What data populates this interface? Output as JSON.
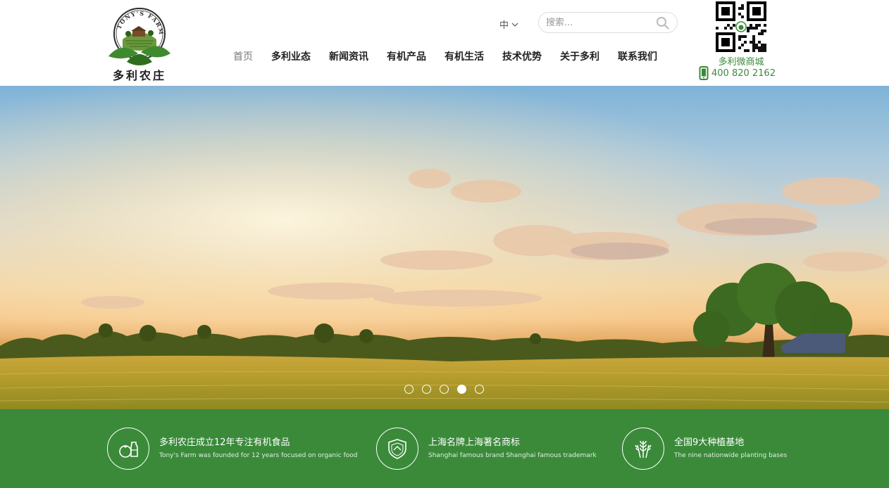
{
  "brand": {
    "name": "多利农庄",
    "badge_text": "TONY'S FARM"
  },
  "header": {
    "language": "中",
    "search": {
      "placeholder": "搜索..."
    },
    "nav": [
      {
        "label": "首页",
        "active": true
      },
      {
        "label": "多利业态"
      },
      {
        "label": "新闻资讯"
      },
      {
        "label": "有机产品"
      },
      {
        "label": "有机生活"
      },
      {
        "label": "技术优势"
      },
      {
        "label": "关于多利"
      },
      {
        "label": "联系我们"
      }
    ],
    "qr_label": "多利微商城",
    "phone": "400 820 2162"
  },
  "hero": {
    "slides_count": 5,
    "active_slide": 4
  },
  "features": [
    {
      "icon": "tomato-bottle-icon",
      "title": "多利农庄成立12年专注有机食品",
      "subtitle": "Tony's Farm was founded for 12 years focused on organic food"
    },
    {
      "icon": "shield-badge-icon",
      "title": "上海名牌上海著名商标",
      "subtitle": "Shanghai famous brand Shanghai famous trademark"
    },
    {
      "icon": "wheat-icon",
      "title": "全国9大种植基地",
      "subtitle": "The nine nationwide planting bases"
    }
  ],
  "colors": {
    "brand_green": "#3a8a3a",
    "nav_text": "#222222",
    "nav_active": "#777777"
  }
}
